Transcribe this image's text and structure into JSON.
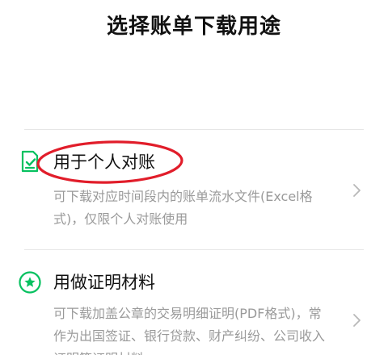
{
  "header": {
    "title": "选择账单下载用途"
  },
  "options": [
    {
      "icon": "document-check-icon",
      "title": "用于个人对账",
      "description": "可下载对应时间段内的账单流水文件(Excel格式)，仅限个人对账使用"
    },
    {
      "icon": "star-badge-icon",
      "title": "用做证明材料",
      "description": "可下载加盖公章的交易明细证明(PDF格式)，常作为出国签证、银行贷款、财产纠纷、公司收入证明等证明材料"
    }
  ],
  "colors": {
    "accent": "#07c160",
    "annotation": "#e11d2a",
    "text_primary": "#111111",
    "text_secondary": "#9a9a9a",
    "divider": "#e6e6e6"
  }
}
